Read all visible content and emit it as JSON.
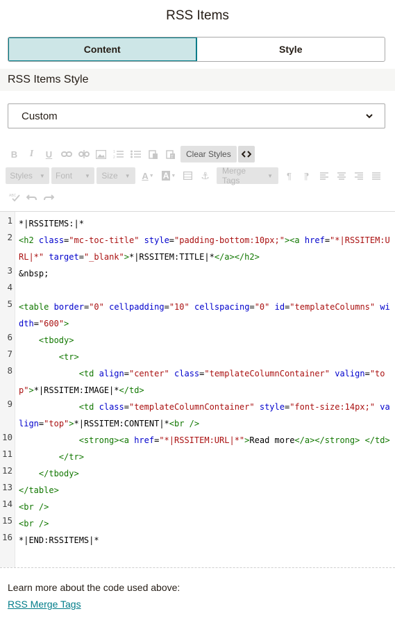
{
  "panel": {
    "title": "RSS Items"
  },
  "tabs": [
    {
      "label": "Content",
      "active": true
    },
    {
      "label": "Style",
      "active": false
    }
  ],
  "section": {
    "title": "RSS Items Style"
  },
  "style_select": {
    "value": "Custom"
  },
  "toolbar": {
    "row1": [
      "bold-icon",
      "italic-icon",
      "underline-icon",
      "link-icon",
      "unlink-icon",
      "image-icon",
      "numbered-list-icon",
      "bulleted-list-icon",
      "paste-icon",
      "paste-text-icon"
    ],
    "clear_styles_label": "Clear Styles",
    "code_view_icon": "code-view-icon",
    "styles_label": "Styles",
    "font_label": "Font",
    "size_label": "Size",
    "row2_icons": [
      "text-color-icon",
      "background-color-icon",
      "table-icon",
      "anchor-icon"
    ],
    "merge_tags_label": "Merge Tags",
    "row2_tail_icons": [
      "paragraph-ltr-icon",
      "paragraph-rtl-icon",
      "align-left-icon",
      "align-center-icon",
      "align-right-icon",
      "align-justify-icon"
    ],
    "row3": [
      "spellcheck-icon",
      "undo-icon",
      "redo-icon"
    ]
  },
  "code_lines": [
    {
      "n": "1",
      "html": "*|RSSITEMS:|*"
    },
    {
      "n": "2",
      "html": "<span class=\"t\">&lt;h2</span> <span class=\"a\">class</span>=<span class=\"v\">\"mc-toc-title\"</span> <span class=\"a\">style</span>=<span class=\"v\">\"padding-bottom:10px;\"</span><span class=\"t\">&gt;&lt;a</span> <span class=\"a\">href</span>=<span class=\"v\">\"*|RSSITEM:URL|*\"</span> <span class=\"a\">target</span>=<span class=\"v\">\"_blank\"</span><span class=\"t\">&gt;</span>*|RSSITEM:TITLE|*<span class=\"t\">&lt;/a&gt;&lt;/h2&gt;</span>"
    },
    {
      "n": "",
      "html": "&amp;nbsp;"
    },
    {
      "n": "3",
      "html": ""
    },
    {
      "n": "4",
      "html": ""
    },
    {
      "n": "5",
      "html": "<span class=\"t\">&lt;table</span> <span class=\"a\">border</span>=<span class=\"v\">\"0\"</span> <span class=\"a\">cellpadding</span>=<span class=\"v\">\"10\"</span> <span class=\"a\">cellspacing</span>=<span class=\"v\">\"0\"</span> <span class=\"a\">id</span>=<span class=\"v\">\"templateColumns\"</span> <span class=\"a\">width</span>=<span class=\"v\">\"600\"</span><span class=\"t\">&gt;</span>"
    },
    {
      "n": "6",
      "html": "    <span class=\"t\">&lt;tbody&gt;</span>"
    },
    {
      "n": "7",
      "html": "        <span class=\"t\">&lt;tr&gt;</span>"
    },
    {
      "n": "8",
      "html": "            <span class=\"t\">&lt;td</span> <span class=\"a\">align</span>=<span class=\"v\">\"center\"</span> <span class=\"a\">class</span>=<span class=\"v\">\"templateColumnContainer\"</span> <span class=\"a\">valign</span>=<span class=\"v\">\"top\"</span><span class=\"t\">&gt;</span>*|RSSITEM:IMAGE|*<span class=\"t\">&lt;/td&gt;</span>"
    },
    {
      "n": "9",
      "html": "            <span class=\"t\">&lt;td</span> <span class=\"a\">class</span>=<span class=\"v\">\"templateColumnContainer\"</span> <span class=\"a\">style</span>=<span class=\"v\">\"font-size:14px;\"</span> <span class=\"a\">valign</span>=<span class=\"v\">\"top\"</span><span class=\"t\">&gt;</span>*|RSSITEM:CONTENT|*<span class=\"t\">&lt;br /&gt;</span>"
    },
    {
      "n": "10",
      "html": "            <span class=\"t\">&lt;strong&gt;&lt;a</span> <span class=\"a\">href</span>=<span class=\"v\">\"*|RSSITEM:URL|*\"</span><span class=\"t\">&gt;</span>Read more<span class=\"t\">&lt;/a&gt;&lt;/strong&gt;</span> <span class=\"t\">&lt;/td&gt;</span>"
    },
    {
      "n": "11",
      "html": "        <span class=\"t\">&lt;/tr&gt;</span>"
    },
    {
      "n": "12",
      "html": "    <span class=\"t\">&lt;/tbody&gt;</span>"
    },
    {
      "n": "13",
      "html": "<span class=\"t\">&lt;/table&gt;</span>"
    },
    {
      "n": "14",
      "html": "<span class=\"t\">&lt;br /&gt;</span>"
    },
    {
      "n": "15",
      "html": "<span class=\"t\">&lt;br /&gt;</span>"
    },
    {
      "n": "16",
      "html": "*|END:RSSITEMS|*"
    }
  ],
  "footer": {
    "note": "Learn more about the code used above:",
    "link_label": "RSS Merge Tags"
  }
}
